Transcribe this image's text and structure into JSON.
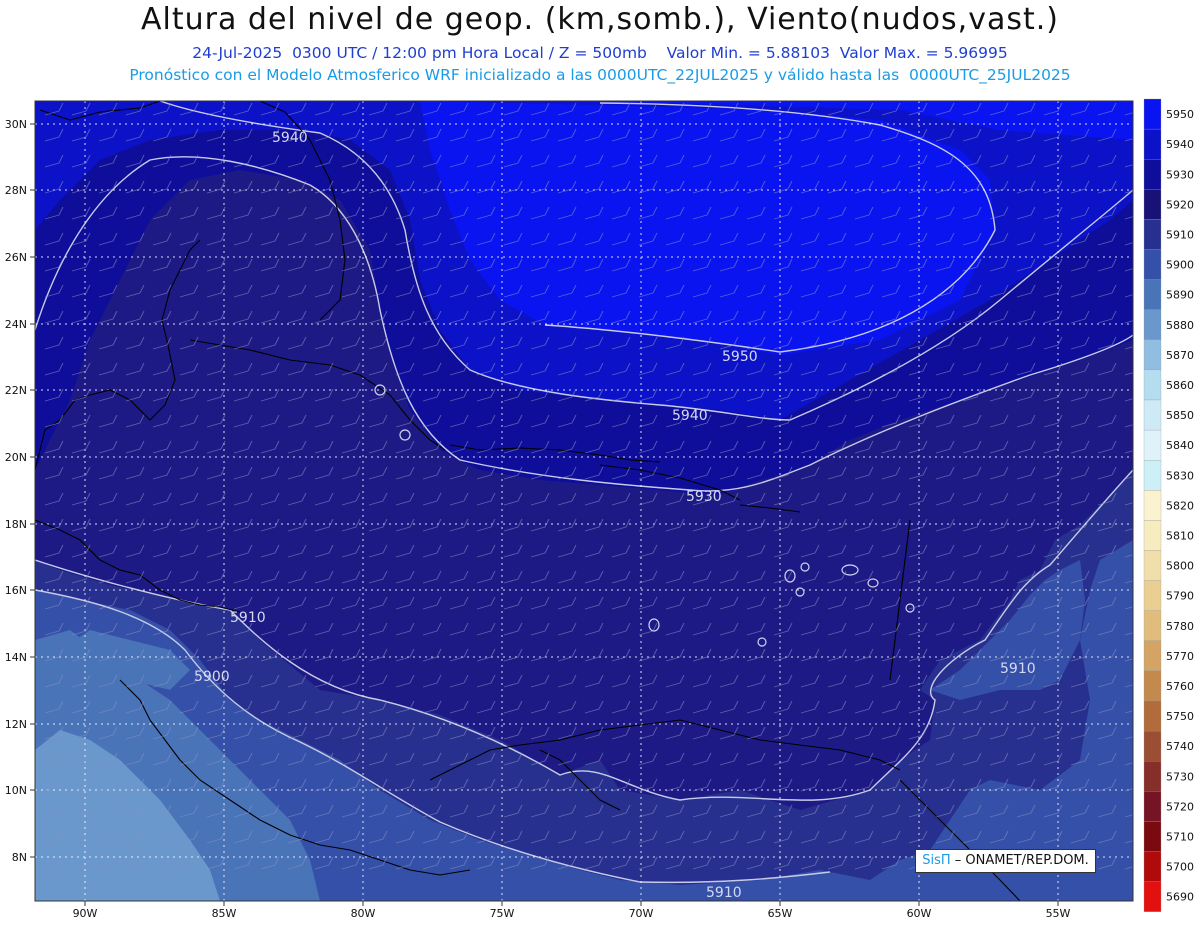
{
  "header": {
    "title": "Altura del nivel de geop. (km,somb.), Viento(nudos,vast.)",
    "line1": "24-Jul-2025  0300 UTC / 12:00 pm Hora Local / Z = 500mb    Valor Min. = 5.88103  Valor Max. = 5.96995",
    "line2": "Pronóstico con el Modelo Atmosferico WRF inicializado a las 0000UTC_22JUL2025 y válido hasta las  0000UTC_25JUL2025"
  },
  "axes": {
    "lat_labels": [
      "30N",
      "28N",
      "26N",
      "24N",
      "22N",
      "20N",
      "18N",
      "16N",
      "14N",
      "12N",
      "10N",
      "8N"
    ],
    "lon_labels": [
      "90W",
      "85W",
      "80W",
      "75W",
      "70W",
      "65W",
      "60W",
      "55W"
    ]
  },
  "contour_labels": [
    "5940",
    "5950",
    "5940",
    "5930",
    "5910",
    "5900",
    "5910",
    "5910"
  ],
  "colorbar": {
    "levels": [
      "5950",
      "5940",
      "5930",
      "5920",
      "5910",
      "5900",
      "5890",
      "5880",
      "5870",
      "5860",
      "5850",
      "5840",
      "5830",
      "5820",
      "5810",
      "5800",
      "5790",
      "5780",
      "5770",
      "5760",
      "5750",
      "5740",
      "5730",
      "5720",
      "5710",
      "5700",
      "5690"
    ],
    "colors": [
      "#0a14f0",
      "#0c12c8",
      "#0e0e9a",
      "#181276",
      "#27308e",
      "#3550a8",
      "#4a74b8",
      "#6a98cc",
      "#90bde0",
      "#b4ddf0",
      "#cfeaf7",
      "#dff2fa",
      "#cdeff7",
      "#fbf3d0",
      "#f7ebc0",
      "#f1dfab",
      "#eacf93",
      "#e0bd7d",
      "#d3a463",
      "#c4894d",
      "#b26c3c",
      "#9b4e33",
      "#852e2a",
      "#741424",
      "#7a0a10",
      "#b00a0a",
      "#e31010"
    ]
  },
  "credit": {
    "brand": "SisΠ",
    "text": "– ONAMET/REP.DOM."
  }
}
